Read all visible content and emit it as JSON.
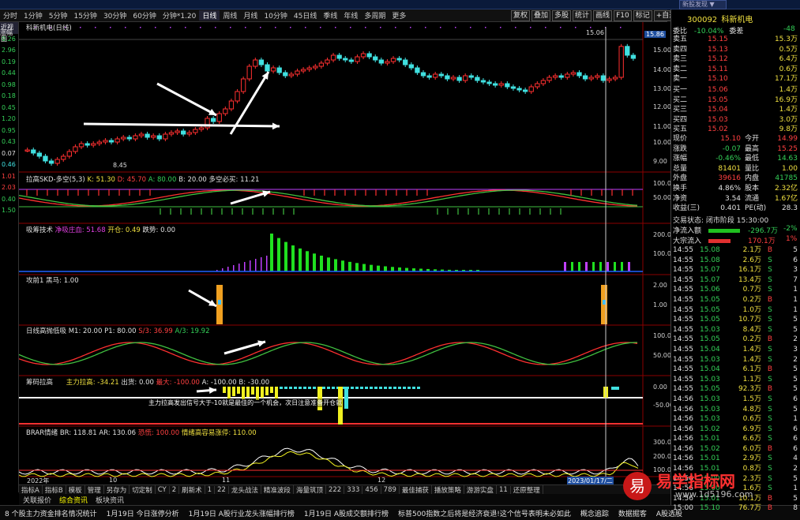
{
  "title_bar": "新股发现 ▼",
  "menu": [
    "分时",
    "1分钟",
    "5分钟",
    "15分钟",
    "30分钟",
    "60分钟",
    "分钟*1.20",
    "日线",
    "周线",
    "月线",
    "10分钟",
    "45日线",
    "季线",
    "年线",
    "多周期",
    "更多"
  ],
  "toolbar": [
    "复权",
    "叠加",
    "多股",
    "统计",
    "画线",
    "F10",
    "标记",
    "+自选",
    "返回"
  ],
  "left_tab": "近视图",
  "left_tab2": "涨幅",
  "left_values": [
    {
      "v": "0.26",
      "c": "g"
    },
    {
      "v": "2.96",
      "c": "g"
    },
    {
      "v": "0.19",
      "c": "g"
    },
    {
      "v": "0.44",
      "c": "g"
    },
    {
      "v": "0.98",
      "c": "g"
    },
    {
      "v": "0.18",
      "c": "g"
    },
    {
      "v": "0.45",
      "c": "g"
    },
    {
      "v": "1.20",
      "c": "g"
    },
    {
      "v": "0.95",
      "c": "g"
    },
    {
      "v": "0.43",
      "c": "g"
    },
    {
      "v": "0.07",
      "c": "w"
    },
    {
      "v": "0.46",
      "c": "c"
    },
    {
      "v": "1.01",
      "c": "r"
    },
    {
      "v": "2.03",
      "c": "r"
    },
    {
      "v": "0.40",
      "c": "g"
    },
    {
      "v": "1.50",
      "c": "g"
    }
  ],
  "main_chart": {
    "label": "科新机电(日线)",
    "high_label": "15.06",
    "low_label": "8.45",
    "price_tag": "15.86",
    "yticks": [
      "15.00",
      "14.00",
      "13.00",
      "12.00",
      "11.00",
      "10.00",
      "9.00"
    ]
  },
  "panels": {
    "p1": {
      "name": "拉高SKD-多空(5,3)",
      "k": "K: 51.30",
      "d": "D: 45.70",
      "a": "A: 80.00",
      "b": "B: 20.00",
      "extra": "多空必买: 11.21",
      "yticks": [
        "100.0",
        "50.00"
      ]
    },
    "p2": {
      "name": "吸筹技术",
      "a": "净吸庄血: 51.68",
      "b": "开仓: 0.49",
      "c": "跌势: 0.00",
      "yticks": [
        "200.0",
        "100.0"
      ]
    },
    "p3": {
      "name": "攻前1",
      "a": "黑马: 1.00",
      "yticks": [
        "2.00",
        "1.00"
      ]
    },
    "p4": {
      "name": "日线高抛低吸",
      "a": "M1: 20.00",
      "b": "P1: 80.00",
      "c": "S/3: 36.99",
      "d": "A/3: 19.92",
      "yticks": [
        "100.0",
        "50.00"
      ]
    },
    "p5": {
      "name": "筹码拉高",
      "a": "主力拉高: -34.21",
      "b": "出货: 0.00",
      "c": "最大: -100.00",
      "d": "A: -100.00",
      "e": "B: -30.00",
      "note": "主力拉高发出信号大于-10就是最佳的一个机会，次日注意准备开仓就",
      "yticks": [
        "0.00",
        "-50.00"
      ]
    },
    "p6": {
      "name": "BRAR情绪",
      "a": "BR: 118.81",
      "b": "AR: 130.06",
      "c": "恐慌: 100.00",
      "d": "情绪高容易涨停: 110.00",
      "yticks": [
        "300.0",
        "200.0",
        "100.0"
      ]
    }
  },
  "date_labels": [
    "2022年",
    "10",
    "11",
    "12",
    "2023/01/17/二"
  ],
  "bottom_tabs1": [
    "指标A",
    "指标B",
    "模板",
    "管理",
    "另存为",
    "切定制",
    "CY",
    "2",
    "刷新术",
    "1",
    "22",
    "龙头战法",
    "精准波段",
    "海量筑顶",
    "222",
    "333",
    "456",
    "789",
    "最佳捕获",
    "播放策略",
    "游游实盘",
    "11",
    "还原整理"
  ],
  "bottom_tabs2": [
    "关联报价",
    "综合资讯",
    "板块资讯"
  ],
  "ticker": [
    "8 个股主力资金排名情况统计",
    "1月19日 今日涨停分析",
    "1月19日 A股行业龙头涨幅排行榜",
    "1月19日 A股成交额排行榜",
    "标普500指数之后将是经济衰退!这个信号表明未必如此",
    "概念追踪",
    "数据掘客",
    "A股选股"
  ],
  "watermark": {
    "brand": "易学指标网",
    "url": "www.1d5196.com",
    "logo": "易"
  },
  "quote": {
    "code": "300092",
    "name": "科新机电",
    "webi_label": "委比",
    "webi": "-10.04%",
    "wecha_label": "委差",
    "wecha": "-48",
    "asks": [
      {
        "l": "卖五",
        "p": "15.15",
        "v": "15.3万"
      },
      {
        "l": "卖四",
        "p": "15.13",
        "v": "0.5万"
      },
      {
        "l": "卖三",
        "p": "15.12",
        "v": "6.4万"
      },
      {
        "l": "卖二",
        "p": "15.11",
        "v": "0.6万"
      },
      {
        "l": "卖一",
        "p": "15.10",
        "v": "17.1万"
      }
    ],
    "bids": [
      {
        "l": "买一",
        "p": "15.06",
        "v": "1.4万"
      },
      {
        "l": "买二",
        "p": "15.05",
        "v": "16.9万"
      },
      {
        "l": "买三",
        "p": "15.04",
        "v": "1.4万"
      },
      {
        "l": "买四",
        "p": "15.03",
        "v": "3.0万"
      },
      {
        "l": "买五",
        "p": "15.02",
        "v": "9.8万"
      }
    ],
    "stats": [
      {
        "a": "现价",
        "av": "15.10",
        "b": "今开",
        "bv": "14.99"
      },
      {
        "a": "涨跌",
        "av": "-0.07",
        "b": "最高",
        "bv": "15.25"
      },
      {
        "a": "涨幅",
        "av": "-0.46%",
        "b": "最低",
        "bv": "14.63"
      },
      {
        "a": "总量",
        "av": "81401",
        "b": "量比",
        "bv": "1.00"
      },
      {
        "a": "外盘",
        "av": "39616",
        "b": "内盘",
        "bv": "41785"
      },
      {
        "a": "换手",
        "av": "4.86%",
        "b": "股本",
        "bv": "2.32亿"
      },
      {
        "a": "净资",
        "av": "3.54",
        "b": "流通",
        "bv": "1.67亿"
      },
      {
        "a": "收益(三)",
        "av": "0.401",
        "b": "PE(动)",
        "bv": "28.3"
      }
    ],
    "state": "交易状态: 闭市阶段 15:30:00",
    "flow1_label": "净流入额",
    "flow1_val": "-296.7万",
    "flow1_pct": "-2%",
    "flow2_label": "大宗流入",
    "flow2_val": "170.1万",
    "flow2_pct": "1%",
    "trades": [
      {
        "t": "14:55",
        "p": "15.08",
        "v": "2.1万",
        "s": "B",
        "n": "5"
      },
      {
        "t": "14:55",
        "p": "15.08",
        "v": "2.6万",
        "s": "S",
        "n": "6"
      },
      {
        "t": "14:55",
        "p": "15.07",
        "v": "16.1万",
        "s": "S",
        "n": "3"
      },
      {
        "t": "14:55",
        "p": "15.07",
        "v": "13.4万",
        "s": "S",
        "n": "7"
      },
      {
        "t": "14:55",
        "p": "15.06",
        "v": "0.7万",
        "s": "S",
        "n": "1"
      },
      {
        "t": "14:55",
        "p": "15.05",
        "v": "0.2万",
        "s": "B",
        "n": "1"
      },
      {
        "t": "14:55",
        "p": "15.05",
        "v": "1.0万",
        "s": "S",
        "n": "1"
      },
      {
        "t": "14:55",
        "p": "15.05",
        "v": "10.7万",
        "s": "S",
        "n": "5"
      },
      {
        "t": "14:55",
        "p": "15.03",
        "v": "8.4万",
        "s": "S",
        "n": "5"
      },
      {
        "t": "14:55",
        "p": "15.05",
        "v": "0.2万",
        "s": "B",
        "n": "2"
      },
      {
        "t": "14:55",
        "p": "15.04",
        "v": "1.4万",
        "s": "S",
        "n": "3"
      },
      {
        "t": "14:55",
        "p": "15.03",
        "v": "1.4万",
        "s": "S",
        "n": "2"
      },
      {
        "t": "14:55",
        "p": "15.04",
        "v": "6.1万",
        "s": "B",
        "n": "5"
      },
      {
        "t": "14:55",
        "p": "15.03",
        "v": "1.1万",
        "s": "S",
        "n": "5"
      },
      {
        "t": "14:55",
        "p": "15.05",
        "v": "92.3万",
        "s": "B",
        "n": "5"
      },
      {
        "t": "14:56",
        "p": "15.03",
        "v": "1.5万",
        "s": "S",
        "n": "6"
      },
      {
        "t": "14:56",
        "p": "15.03",
        "v": "4.8万",
        "s": "S",
        "n": "5"
      },
      {
        "t": "14:56",
        "p": "15.03",
        "v": "0.6万",
        "s": "S",
        "n": "1"
      },
      {
        "t": "14:56",
        "p": "15.02",
        "v": "6.9万",
        "s": "S",
        "n": "6"
      },
      {
        "t": "14:56",
        "p": "15.01",
        "v": "6.6万",
        "s": "S",
        "n": "6"
      },
      {
        "t": "14:56",
        "p": "15.02",
        "v": "6.0万",
        "s": "B",
        "n": "6"
      },
      {
        "t": "14:56",
        "p": "15.01",
        "v": "2.9万",
        "s": "S",
        "n": "4"
      },
      {
        "t": "14:56",
        "p": "15.01",
        "v": "0.8万",
        "s": "S",
        "n": "2"
      },
      {
        "t": "14:56",
        "p": "15.00",
        "v": "2.3万",
        "s": "S",
        "n": "5"
      },
      {
        "t": "14:56",
        "p": "15.00",
        "v": "1.6万",
        "s": "S",
        "n": "1"
      },
      {
        "t": "14:56",
        "p": "15.01",
        "v": "10.1万",
        "s": "B",
        "n": "5"
      },
      {
        "t": "15:00",
        "p": "15.10",
        "v": "76.7万",
        "s": "B",
        "n": "8"
      }
    ]
  },
  "chart_data": {
    "type": "candlestick",
    "note_values": "approximate daily closes",
    "closes": [
      9.3,
      9.1,
      8.9,
      8.6,
      8.45,
      8.7,
      8.9,
      9.2,
      9.5,
      9.7,
      9.6,
      9.7,
      9.8,
      9.9,
      9.8,
      10.0,
      10.1,
      10.0,
      10.2,
      10.3,
      10.1,
      10.2,
      10.0,
      10.3,
      10.4,
      10.5,
      10.3,
      10.4,
      10.6,
      10.7,
      11.3,
      11.1,
      11.6,
      11.9,
      12.4,
      13.0,
      13.8,
      14.6,
      15.0,
      14.7,
      14.3,
      14.5,
      14.2,
      14.0,
      14.1,
      14.3,
      14.4,
      14.5,
      14.6,
      14.8,
      15.0,
      15.3,
      15.1,
      15.0,
      14.9,
      15.2,
      15.4,
      15.2,
      15.0,
      14.8,
      14.9,
      15.1,
      15.0,
      14.7,
      14.5,
      14.2,
      14.0,
      13.9,
      14.1,
      14.0,
      13.8,
      13.9,
      13.7,
      14.0,
      13.9,
      13.7,
      13.6,
      13.5,
      13.4,
      13.5,
      13.3,
      13.2,
      13.1,
      13.0,
      13.3,
      13.5,
      13.7,
      13.9,
      14.0,
      13.9,
      14.1,
      14.2,
      14.0,
      13.8,
      13.9,
      14.0,
      13.7,
      13.8,
      13.9,
      15.86,
      15.3,
      15.1
    ],
    "ylim": [
      8.0,
      16.5
    ]
  }
}
